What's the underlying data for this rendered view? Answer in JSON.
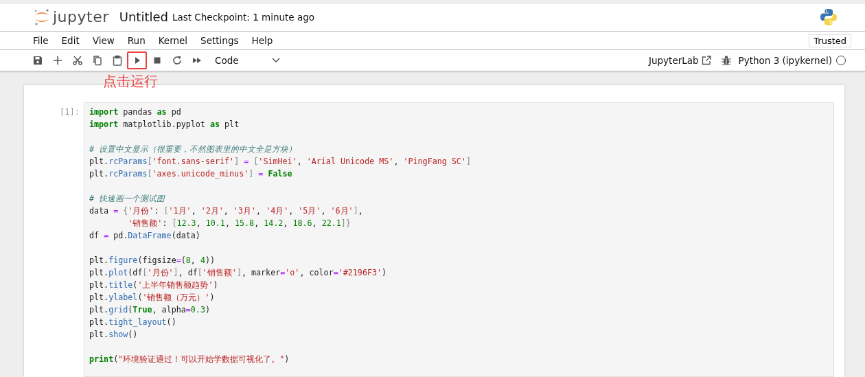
{
  "header": {
    "logo_text": "jupyter",
    "notebook_title": "Untitled",
    "checkpoint": "Last Checkpoint: 1 minute ago"
  },
  "menu": [
    {
      "label": "File"
    },
    {
      "label": "Edit"
    },
    {
      "label": "View"
    },
    {
      "label": "Run"
    },
    {
      "label": "Kernel"
    },
    {
      "label": "Settings"
    },
    {
      "label": "Help"
    }
  ],
  "trusted": "Trusted",
  "toolbar": {
    "tools": [
      {
        "kind": "save",
        "highlighted": false
      },
      {
        "kind": "add",
        "highlighted": false
      },
      {
        "kind": "cut",
        "highlighted": false
      },
      {
        "kind": "copy",
        "highlighted": false
      },
      {
        "kind": "paste",
        "highlighted": false
      },
      {
        "kind": "run",
        "highlighted": true
      },
      {
        "kind": "stop",
        "highlighted": false
      },
      {
        "kind": "restart",
        "highlighted": false
      },
      {
        "kind": "run-all",
        "highlighted": false
      }
    ],
    "cell_type": "Code",
    "jupyterlab": "JupyterLab",
    "kernel": "Python 3 (ipykernel)",
    "kernel_busy": false
  },
  "annotation": "点击运行",
  "cell": {
    "prompt": "[1]:",
    "lines": [
      {
        "kind": "code",
        "tokens": [
          {
            "kind": "k",
            "text": "import"
          },
          {
            "text": " pandas "
          },
          {
            "kind": "k",
            "text": "as"
          },
          {
            "text": " pd"
          }
        ]
      },
      {
        "kind": "code",
        "tokens": [
          {
            "kind": "k",
            "text": "import"
          },
          {
            "text": " matplotlib.pyplot "
          },
          {
            "kind": "k",
            "text": "as"
          },
          {
            "text": " plt"
          }
        ]
      },
      {
        "kind": "blank"
      },
      {
        "kind": "code",
        "tokens": [
          {
            "kind": "c",
            "text": "# 设置中文显示（很重要，不然图表里的中文全是方块）"
          }
        ]
      },
      {
        "kind": "code",
        "tokens": [
          {
            "text": "plt."
          },
          {
            "kind": "f",
            "text": "rcParams"
          },
          {
            "kind": "p",
            "text": "["
          },
          {
            "kind": "s",
            "text": "'font.sans-serif'"
          },
          {
            "kind": "p",
            "text": "]"
          },
          {
            "kind": "o",
            "text": " = "
          },
          {
            "kind": "p",
            "text": "["
          },
          {
            "kind": "s",
            "text": "'SimHei'"
          },
          {
            "text": ", "
          },
          {
            "kind": "s",
            "text": "'Arial Unicode MS'"
          },
          {
            "text": ", "
          },
          {
            "kind": "s",
            "text": "'PingFang SC'"
          },
          {
            "kind": "p",
            "text": "]"
          }
        ]
      },
      {
        "kind": "code",
        "tokens": [
          {
            "text": "plt."
          },
          {
            "kind": "f",
            "text": "rcParams"
          },
          {
            "kind": "p",
            "text": "["
          },
          {
            "kind": "s",
            "text": "'axes.unicode_minus'"
          },
          {
            "kind": "p",
            "text": "]"
          },
          {
            "kind": "o",
            "text": " = "
          },
          {
            "kind": "k",
            "text": "False"
          }
        ]
      },
      {
        "kind": "blank"
      },
      {
        "kind": "code",
        "tokens": [
          {
            "kind": "c",
            "text": "# 快速画一个测试图"
          }
        ]
      },
      {
        "kind": "code",
        "tokens": [
          {
            "text": "data "
          },
          {
            "kind": "o",
            "text": "= "
          },
          {
            "kind": "p",
            "text": "{"
          },
          {
            "kind": "s",
            "text": "'月份'"
          },
          {
            "text": ": "
          },
          {
            "kind": "p",
            "text": "["
          },
          {
            "kind": "s",
            "text": "'1月'"
          },
          {
            "text": ", "
          },
          {
            "kind": "s",
            "text": "'2月'"
          },
          {
            "text": ", "
          },
          {
            "kind": "s",
            "text": "'3月'"
          },
          {
            "text": ", "
          },
          {
            "kind": "s",
            "text": "'4月'"
          },
          {
            "text": ", "
          },
          {
            "kind": "s",
            "text": "'5月'"
          },
          {
            "text": ", "
          },
          {
            "kind": "s",
            "text": "'6月'"
          },
          {
            "kind": "p",
            "text": "]"
          },
          {
            "text": ","
          }
        ]
      },
      {
        "kind": "code",
        "tokens": [
          {
            "kind": "s",
            "text": "        '销售额'"
          },
          {
            "text": ": "
          },
          {
            "kind": "p",
            "text": "["
          },
          {
            "kind": "n",
            "text": "12.3"
          },
          {
            "text": ", "
          },
          {
            "kind": "n",
            "text": "10.1"
          },
          {
            "text": ", "
          },
          {
            "kind": "n",
            "text": "15.8"
          },
          {
            "text": ", "
          },
          {
            "kind": "n",
            "text": "14.2"
          },
          {
            "text": ", "
          },
          {
            "kind": "n",
            "text": "18.6"
          },
          {
            "text": ", "
          },
          {
            "kind": "n",
            "text": "22.1"
          },
          {
            "kind": "p",
            "text": "]}"
          }
        ]
      },
      {
        "kind": "code",
        "tokens": [
          {
            "text": "df "
          },
          {
            "kind": "o",
            "text": "="
          },
          {
            "text": " pd."
          },
          {
            "kind": "f",
            "text": "DataFrame"
          },
          {
            "text": "(data)"
          }
        ]
      },
      {
        "kind": "blank"
      },
      {
        "kind": "code",
        "tokens": [
          {
            "text": "plt."
          },
          {
            "kind": "f",
            "text": "figure"
          },
          {
            "text": "(figsize"
          },
          {
            "kind": "o",
            "text": "="
          },
          {
            "text": "("
          },
          {
            "kind": "n",
            "text": "8"
          },
          {
            "text": ", "
          },
          {
            "kind": "n",
            "text": "4"
          },
          {
            "text": "))"
          }
        ]
      },
      {
        "kind": "code",
        "tokens": [
          {
            "text": "plt."
          },
          {
            "kind": "f",
            "text": "plot"
          },
          {
            "text": "(df"
          },
          {
            "kind": "p",
            "text": "["
          },
          {
            "kind": "s",
            "text": "'月份'"
          },
          {
            "kind": "p",
            "text": "]"
          },
          {
            "text": ", df"
          },
          {
            "kind": "p",
            "text": "["
          },
          {
            "kind": "s",
            "text": "'销售额'"
          },
          {
            "kind": "p",
            "text": "]"
          },
          {
            "text": ", marker"
          },
          {
            "kind": "o",
            "text": "="
          },
          {
            "kind": "s",
            "text": "'o'"
          },
          {
            "text": ", color"
          },
          {
            "kind": "o",
            "text": "="
          },
          {
            "kind": "s",
            "text": "'#2196F3'"
          },
          {
            "text": ")"
          }
        ]
      },
      {
        "kind": "code",
        "tokens": [
          {
            "text": "plt."
          },
          {
            "kind": "f",
            "text": "title"
          },
          {
            "text": "("
          },
          {
            "kind": "s",
            "text": "'上半年销售额趋势'"
          },
          {
            "text": ")"
          }
        ]
      },
      {
        "kind": "code",
        "tokens": [
          {
            "text": "plt."
          },
          {
            "kind": "f",
            "text": "ylabel"
          },
          {
            "text": "("
          },
          {
            "kind": "s",
            "text": "'销售额（万元）'"
          },
          {
            "text": ")"
          }
        ]
      },
      {
        "kind": "code",
        "tokens": [
          {
            "text": "plt."
          },
          {
            "kind": "f",
            "text": "grid"
          },
          {
            "text": "("
          },
          {
            "kind": "k",
            "text": "True"
          },
          {
            "text": ", alpha"
          },
          {
            "kind": "o",
            "text": "="
          },
          {
            "kind": "n",
            "text": "0.3"
          },
          {
            "text": ")"
          }
        ]
      },
      {
        "kind": "code",
        "tokens": [
          {
            "text": "plt."
          },
          {
            "kind": "f",
            "text": "tight_layout"
          },
          {
            "text": "()"
          }
        ]
      },
      {
        "kind": "code",
        "tokens": [
          {
            "text": "plt."
          },
          {
            "kind": "f",
            "text": "show"
          },
          {
            "text": "()"
          }
        ]
      },
      {
        "kind": "blank"
      },
      {
        "kind": "code",
        "tokens": [
          {
            "kind": "k",
            "text": "print"
          },
          {
            "text": "("
          },
          {
            "kind": "s",
            "text": "\"环境验证通过！可以开始学数据可视化了。\""
          },
          {
            "text": ")"
          }
        ]
      }
    ]
  }
}
